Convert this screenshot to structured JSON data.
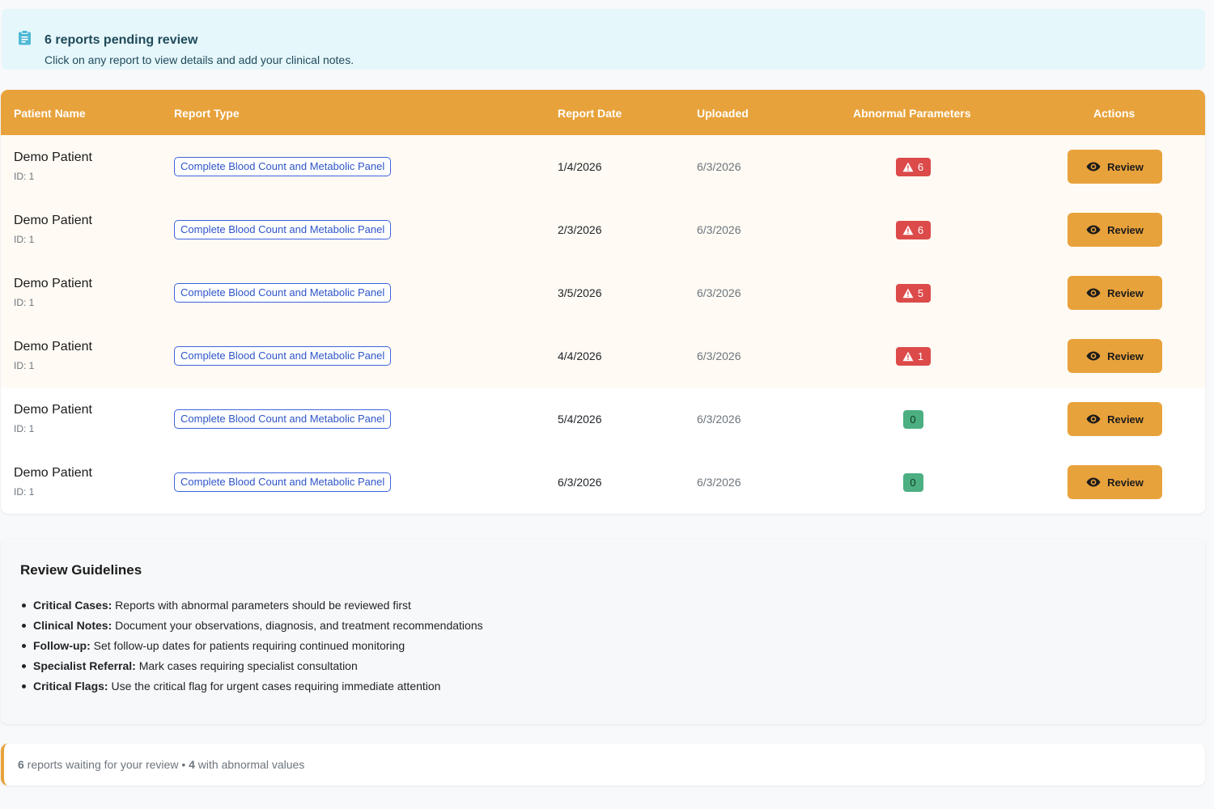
{
  "banner": {
    "title": "6 reports pending review",
    "subtitle": "Click on any report to view details and add your clinical notes.",
    "icon": "clipboard-icon"
  },
  "table": {
    "headers": {
      "patient_name": "Patient Name",
      "report_type": "Report Type",
      "report_date": "Report Date",
      "uploaded": "Uploaded",
      "abnormal": "Abnormal Parameters",
      "actions": "Actions"
    },
    "rows": [
      {
        "name": "Demo Patient",
        "id": "ID: 1",
        "type": "Complete Blood Count and Metabolic Panel",
        "report_date": "1/4/2026",
        "uploaded": "6/3/2026",
        "abnormal": "6",
        "status": "warning",
        "action": "Review"
      },
      {
        "name": "Demo Patient",
        "id": "ID: 1",
        "type": "Complete Blood Count and Metabolic Panel",
        "report_date": "2/3/2026",
        "uploaded": "6/3/2026",
        "abnormal": "6",
        "status": "warning",
        "action": "Review"
      },
      {
        "name": "Demo Patient",
        "id": "ID: 1",
        "type": "Complete Blood Count and Metabolic Panel",
        "report_date": "3/5/2026",
        "uploaded": "6/3/2026",
        "abnormal": "5",
        "status": "warning",
        "action": "Review"
      },
      {
        "name": "Demo Patient",
        "id": "ID: 1",
        "type": "Complete Blood Count and Metabolic Panel",
        "report_date": "4/4/2026",
        "uploaded": "6/3/2026",
        "abnormal": "1",
        "status": "warning",
        "action": "Review"
      },
      {
        "name": "Demo Patient",
        "id": "ID: 1",
        "type": "Complete Blood Count and Metabolic Panel",
        "report_date": "5/4/2026",
        "uploaded": "6/3/2026",
        "abnormal": "0",
        "status": "normal",
        "action": "Review"
      },
      {
        "name": "Demo Patient",
        "id": "ID: 1",
        "type": "Complete Blood Count and Metabolic Panel",
        "report_date": "6/3/2026",
        "uploaded": "6/3/2026",
        "abnormal": "0",
        "status": "normal",
        "action": "Review"
      }
    ]
  },
  "guidelines": {
    "title": "Review Guidelines",
    "items": [
      {
        "label": "Critical Cases:",
        "text": " Reports with abnormal parameters should be reviewed first"
      },
      {
        "label": "Clinical Notes:",
        "text": " Document your observations, diagnosis, and treatment recommendations"
      },
      {
        "label": "Follow-up:",
        "text": " Set follow-up dates for patients requiring continued monitoring"
      },
      {
        "label": "Specialist Referral:",
        "text": " Mark cases requiring specialist consultation"
      },
      {
        "label": "Critical Flags:",
        "text": " Use the critical flag for urgent cases requiring immediate attention"
      }
    ]
  },
  "summary": {
    "count": "6",
    "count_text": " reports waiting for your review • ",
    "abnormal_count": "4",
    "abnormal_text": " with abnormal values"
  },
  "colors": {
    "accent": "#e8a23b",
    "banner_bg": "#e6f7fc",
    "danger": "#dc4a4a",
    "success": "#4caf82",
    "link": "#2f55c7"
  }
}
